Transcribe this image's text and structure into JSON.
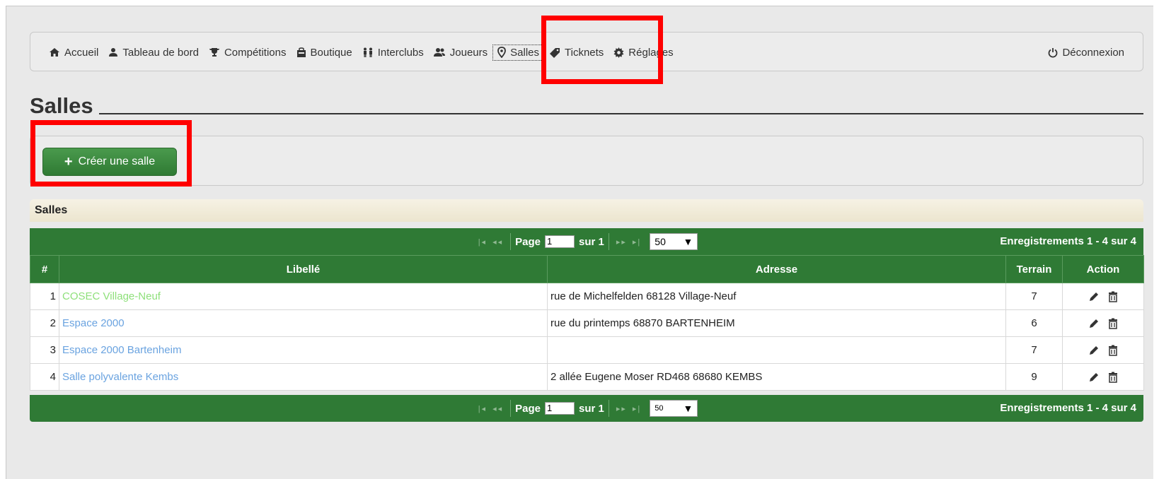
{
  "nav": {
    "items": [
      {
        "label": "Accueil",
        "icon": "home-icon"
      },
      {
        "label": "Tableau de bord",
        "icon": "user-icon"
      },
      {
        "label": "Compétitions",
        "icon": "trophy-icon"
      },
      {
        "label": "Boutique",
        "icon": "shop-icon"
      },
      {
        "label": "Interclubs",
        "icon": "team-icon"
      },
      {
        "label": "Joueurs",
        "icon": "users-icon"
      },
      {
        "label": "Salles",
        "icon": "map-marker-icon",
        "active": true
      },
      {
        "label": "Ticknets",
        "icon": "tag-icon"
      },
      {
        "label": "Réglages",
        "icon": "gear-icon"
      }
    ],
    "logout": "Déconnexion"
  },
  "page_title": "Salles",
  "create_button": "Créer une salle",
  "grid": {
    "caption": "Salles",
    "pager": {
      "page_label": "Page",
      "page_value": "1",
      "of_label": "sur 1",
      "per_page": "50",
      "records": "Enregistrements 1 - 4 sur 4"
    },
    "columns": [
      "#",
      "Libellé",
      "Adresse",
      "Terrain",
      "Action"
    ],
    "rows": [
      {
        "num": "1",
        "libelle": "COSEC Village-Neuf",
        "adresse": "rue de Michelfelden  68128 Village-Neuf",
        "terrain": "7"
      },
      {
        "num": "2",
        "libelle": "Espace 2000",
        "adresse": "rue du printemps  68870 BARTENHEIM",
        "terrain": "6"
      },
      {
        "num": "3",
        "libelle": "Espace 2000 Bartenheim",
        "adresse": "",
        "terrain": "7"
      },
      {
        "num": "4",
        "libelle": "Salle polyvalente Kembs",
        "adresse": "2 allée Eugene Moser RD468 68680 KEMBS",
        "terrain": "9"
      }
    ]
  },
  "colors": {
    "accent_green": "#2f7a35",
    "highlight_red": "#ff0000",
    "link_blue": "#6aa3e0"
  }
}
